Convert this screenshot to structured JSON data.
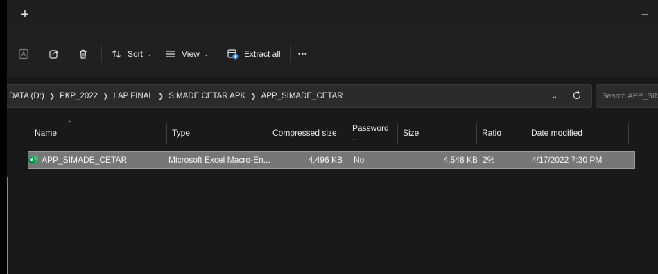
{
  "titlebar": {
    "new_tab_glyph": "+",
    "minimize_glyph": "–"
  },
  "toolbar": {
    "sort_label": "Sort",
    "view_label": "View",
    "extract_all_label": "Extract all",
    "more_label": "•••"
  },
  "address": {
    "crumbs": [
      "DATA (D:)",
      "PKP_2022",
      "LAP FINAL",
      "SIMADE CETAR APK",
      "APP_SIMADE_CETAR"
    ],
    "search_placeholder": "Search APP_SIMADE_CETAR"
  },
  "columns": {
    "name": "Name",
    "type": "Type",
    "compressed_size": "Compressed size",
    "password": "Password ...",
    "size": "Size",
    "ratio": "Ratio",
    "date_modified": "Date modified"
  },
  "files": [
    {
      "name": "APP_SIMADE_CETAR",
      "type": "Microsoft Excel Macro-En...",
      "compressed_size": "4,496 KB",
      "password": "No",
      "size": "4,548 KB",
      "ratio": "2%",
      "date_modified": "4/17/2022 7:30 PM",
      "icon": "excel-file-icon"
    }
  ],
  "colors": {
    "background": "#191919",
    "toolbar": "#202020",
    "selected_row": "#777777",
    "excel_green": "#1f7a45"
  }
}
